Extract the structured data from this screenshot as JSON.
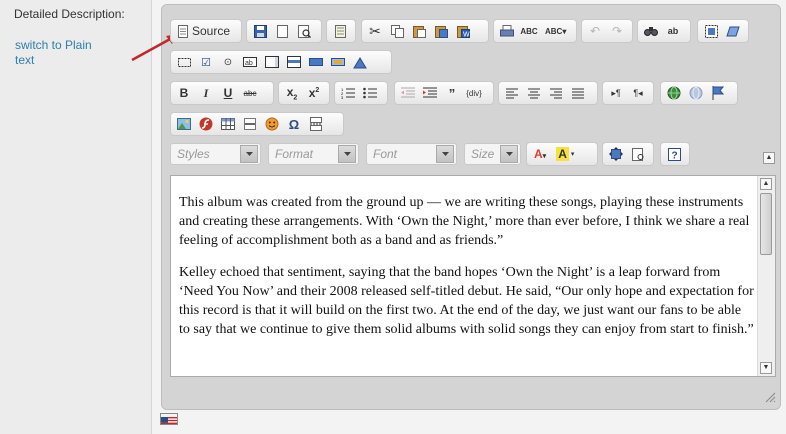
{
  "form": {
    "label": "Detailed Description:",
    "switch_link": "switch to Plain text"
  },
  "toolbar": {
    "source_label": "Source",
    "styles_placeholder": "Styles",
    "format_placeholder": "Format",
    "font_placeholder": "Font",
    "size_placeholder": "Size"
  },
  "content": {
    "paragraphs": [
      "This album was created from the ground up — we are writing these songs, playing these instruments and creating these arrangements. With ‘Own the Night,’ more than ever before, I think we share a real feeling of accomplishment both as a band and as friends.”",
      "Kelley echoed that sentiment, saying that the band hopes ‘Own the Night’ is a leap forward from ‘Need You Now’ and their 2008 released self-titled debut. He said, “Our only hope and expectation for this record is that it will build on the first two. At the end of the day, we just want our fans to be able to say that we continue to give them solid albums with solid songs they can enjoy from start to finish.”"
    ]
  },
  "icons": [
    "source-icon",
    "save-icon",
    "new-page-icon",
    "preview-icon",
    "templates-icon",
    "cut-icon",
    "copy-icon",
    "paste-icon",
    "paste-text-icon",
    "paste-word-icon",
    "print-icon",
    "spellcheck-icon",
    "scayt-icon",
    "undo-icon",
    "redo-icon",
    "find-icon",
    "replace-icon",
    "select-all-icon",
    "remove-format-icon",
    "form-icon",
    "checkbox-icon",
    "radio-icon",
    "textfield-icon",
    "textarea-icon",
    "select-icon",
    "button-icon",
    "image-button-icon",
    "hidden-field-icon",
    "bold-icon",
    "italic-icon",
    "underline-icon",
    "strike-icon",
    "subscript-icon",
    "superscript-icon",
    "numbered-list-icon",
    "bulleted-list-icon",
    "outdent-icon",
    "indent-icon",
    "blockquote-icon",
    "div-icon",
    "align-left-icon",
    "align-center-icon",
    "align-right-icon",
    "justify-icon",
    "ltr-icon",
    "rtl-icon",
    "link-icon",
    "unlink-icon",
    "anchor-icon",
    "image-icon",
    "flash-icon",
    "table-icon",
    "horizontal-rule-icon",
    "smiley-icon",
    "special-char-icon",
    "page-break-icon",
    "text-color-icon",
    "bg-color-icon",
    "maximize-icon",
    "show-blocks-icon",
    "about-icon",
    "us-flag-icon"
  ],
  "colors": {
    "link": "#2c7fae",
    "arrow": "#c0282d",
    "editor_bg": "#d4d4d4"
  }
}
